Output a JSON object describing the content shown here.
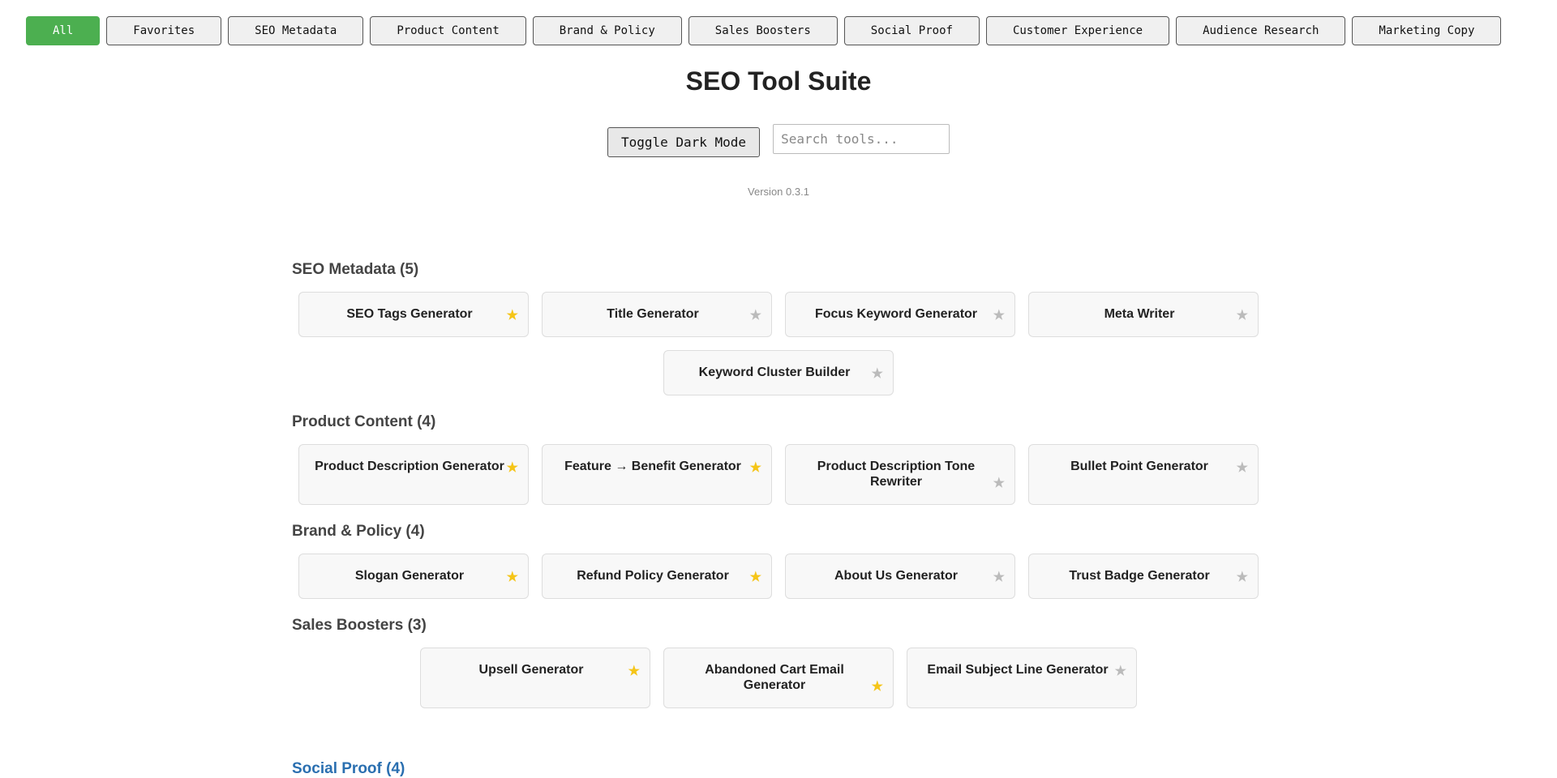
{
  "filters": [
    {
      "label": "All",
      "active": true
    },
    {
      "label": "Favorites"
    },
    {
      "label": "SEO Metadata"
    },
    {
      "label": "Product Content"
    },
    {
      "label": "Brand & Policy"
    },
    {
      "label": "Sales Boosters"
    },
    {
      "label": "Social Proof"
    },
    {
      "label": "Customer Experience"
    },
    {
      "label": "Audience Research"
    },
    {
      "label": "Marketing Copy"
    }
  ],
  "header": {
    "title": "SEO Tool Suite",
    "toggle_label": "Toggle Dark Mode",
    "search_placeholder": "Search tools...",
    "version": "Version 0.3.1"
  },
  "colors": {
    "accent": "#4caf50",
    "favorite_star": "#f5c518",
    "inactive_star": "#bbbbbb"
  },
  "icons": {
    "favorite": "star-icon"
  },
  "sections": [
    {
      "title": "SEO Metadata (5)",
      "tools": [
        {
          "label": "SEO Tags Generator",
          "favorite": true
        },
        {
          "label": "Title Generator",
          "favorite": false
        },
        {
          "label": "Focus Keyword Generator",
          "favorite": false
        },
        {
          "label": "Meta Writer",
          "favorite": false
        },
        {
          "label": "Keyword Cluster Builder",
          "favorite": false
        }
      ]
    },
    {
      "title": "Product Content (4)",
      "tools": [
        {
          "label": "Product Description Generator",
          "favorite": true
        },
        {
          "label": "Feature → Benefit Generator",
          "favorite": true
        },
        {
          "label": "Product Description Tone Rewriter",
          "favorite": false,
          "star_mid": true
        },
        {
          "label": "Bullet Point Generator",
          "favorite": false
        }
      ]
    },
    {
      "title": "Brand & Policy (4)",
      "tools": [
        {
          "label": "Slogan Generator",
          "favorite": true
        },
        {
          "label": "Refund Policy Generator",
          "favorite": true
        },
        {
          "label": "About Us Generator",
          "favorite": false
        },
        {
          "label": "Trust Badge Generator",
          "favorite": false
        }
      ]
    },
    {
      "title": "Sales Boosters (3)",
      "tools": [
        {
          "label": "Upsell Generator",
          "favorite": true
        },
        {
          "label": "Abandoned Cart Email Generator",
          "favorite": true,
          "star_mid": true
        },
        {
          "label": "Email Subject Line Generator",
          "favorite": false
        }
      ]
    }
  ],
  "next_section_title": "Social Proof (4)"
}
